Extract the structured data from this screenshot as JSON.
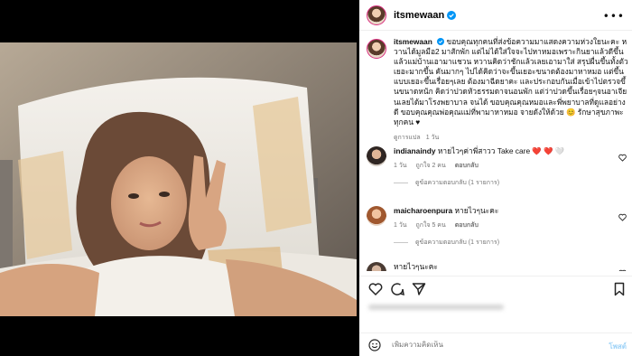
{
  "post": {
    "author": "itsmewaan",
    "more_icon": "more-horizontal-icon",
    "caption": "ขอบคุณทุกคนที่ส่งข้อความมาแสดงความห่วงใยนะคะ หวานได้มูลมือ2 มาสักพัก แต่ไม่ได้ใส่ใจจะไปหาหมอเพราะกินยาแล้วดีขึ้น แล้วแม่บ้านเอามาแชวน หวานคิดว่าชักแล้วเลยเอามาใส่ สรุปผื่นขึ้นทั้งตัว เยอะมากขึ้น คันมากๆ ไปได้คิดว่าจะขึ้นเยอะขนาดต้องมาหาหมอ แต่ขึ้นแบบเยอะขึ้นเรื่อยๆเลย ต้องมาฉีดยาคะ และประกอบกันเมื่อเข้าไปตรวจขึ้นขนาดหนัก คิดว่าปวดหัวธรรมดาจนอนพัก แต่ว่าปวดขึ้นเรื่อยๆจนอาเจียนเลยได้มาโรงพยาบาล จนได้ ขอบคุณคุณหมอและพี่พยาบาลที่ดูแลอย่างดี ขอบคุณคุณพ่อคุณแม่ที่พามาหาหมอ จายดังให้ด้วย 😊 รักษาสุขภาพะทุกคน ♥",
    "translation_link": "ดูการแปล",
    "age": "1 วัน"
  },
  "comments": [
    {
      "user": "indianaindy",
      "text": "หายไวๆค่าพี่สาวว Take care ❤️ ❤️ 🤍",
      "age": "1 วัน",
      "likes": "ถูกใจ 2 คน",
      "reply_label": "ตอบกลับ",
      "view_replies": "ดูข้อความตอบกลับ (1 รายการ)"
    },
    {
      "user": "maicharoenpura",
      "text": "หายไวๆนะคะ",
      "age": "1 วัน",
      "likes": "ถูกใจ 5 คน",
      "reply_label": "ตอบกลับ",
      "view_replies": "ดูข้อความตอบกลับ (1 รายการ)"
    },
    {
      "user": "",
      "text": "หายไวๆนะคะ",
      "age": "",
      "likes": "",
      "reply_label": "",
      "view_replies": ""
    }
  ],
  "add_comment": {
    "placeholder": "เพิ่มความคิดเห็น",
    "post_label": "โพสต์"
  },
  "icons": {
    "like": "heart-icon",
    "comment": "comment-icon",
    "share": "share-icon",
    "save": "bookmark-icon",
    "emoji": "emoji-icon",
    "verified": "verified-badge-icon"
  },
  "colors": {
    "accent": "#0095f6",
    "verified": "#0095f6",
    "heart_red": "#ed4956",
    "muted": "#737373"
  }
}
